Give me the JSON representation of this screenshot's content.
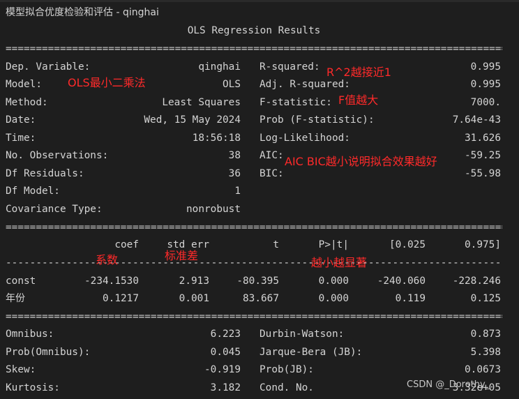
{
  "window_title": "模型拟合优度检验和评估 - qinghai",
  "report_title": "OLS Regression Results",
  "rules": {
    "double": "================================================================================================================",
    "single": "----------------------------------------------------------------------------------------------------------------"
  },
  "summary_left": [
    {
      "label": "Dep. Variable:",
      "value": "qinghai"
    },
    {
      "label": "Model:",
      "value": "OLS"
    },
    {
      "label": "Method:",
      "value": "Least Squares"
    },
    {
      "label": "Date:",
      "value": "Wed, 15 May 2024"
    },
    {
      "label": "Time:",
      "value": "18:56:18"
    },
    {
      "label": "No. Observations:",
      "value": "38"
    },
    {
      "label": "Df Residuals:",
      "value": "36"
    },
    {
      "label": "Df Model:",
      "value": "1"
    },
    {
      "label": "Covariance Type:",
      "value": "nonrobust"
    }
  ],
  "summary_right": [
    {
      "label": "R-squared:",
      "value": "0.995"
    },
    {
      "label": "Adj. R-squared:",
      "value": "0.995"
    },
    {
      "label": "F-statistic:",
      "value": "7000."
    },
    {
      "label": "Prob (F-statistic):",
      "value": "7.64e-43"
    },
    {
      "label": "Log-Likelihood:",
      "value": "31.626"
    },
    {
      "label": "AIC:",
      "value": "-59.25"
    },
    {
      "label": "BIC:",
      "value": "-55.98"
    }
  ],
  "coef_table": {
    "headers": [
      "coef",
      "std err",
      "t",
      "P>|t|",
      "[0.025",
      "0.975]"
    ],
    "rows": [
      {
        "name": "const",
        "values": [
          "-234.1530",
          "2.913",
          "-80.395",
          "0.000",
          "-240.060",
          "-228.246"
        ]
      },
      {
        "name": "年份",
        "values": [
          "0.1217",
          "0.001",
          "83.667",
          "0.000",
          "0.119",
          "0.125"
        ]
      }
    ]
  },
  "diagnostics_left": [
    {
      "label": "Omnibus:",
      "value": "6.223"
    },
    {
      "label": "Prob(Omnibus):",
      "value": "0.045"
    },
    {
      "label": "Skew:",
      "value": "-0.919"
    },
    {
      "label": "Kurtosis:",
      "value": "3.182"
    }
  ],
  "diagnostics_right": [
    {
      "label": "Durbin-Watson:",
      "value": "0.873"
    },
    {
      "label": "Jarque-Bera (JB):",
      "value": "5.398"
    },
    {
      "label": "Prob(JB):",
      "value": "0.0673"
    },
    {
      "label": "Cond. No.",
      "value": "3.32e+05"
    }
  ],
  "annotations": {
    "r2": "R^2越接近1",
    "ols": "OLS最小二乘法",
    "f": "F值越大",
    "aic_bic": "AIC BIC越小说明拟合效果越好",
    "coef": "系数",
    "stderr": "标准差",
    "p": "越小越显著"
  },
  "watermark": "CSDN @_Dorothy_",
  "colors": {
    "background": "#1e1e1e",
    "text": "#d4d4d4",
    "annotation": "#ff2a2a"
  }
}
